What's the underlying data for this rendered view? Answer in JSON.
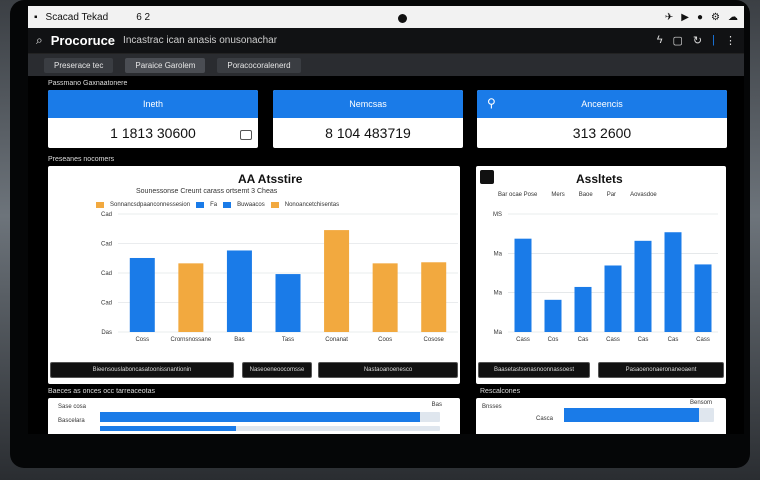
{
  "os_bar": {
    "app_name": "Scacad Tekad",
    "counter": "6 2"
  },
  "header": {
    "title": "Procoruce",
    "subtitle": "Incastrac ican anasis onusonachar"
  },
  "tabs": [
    {
      "label": "Preserace tec"
    },
    {
      "label": "Paraice Garolem"
    },
    {
      "label": "Poracocoralenerd"
    }
  ],
  "kpis": {
    "caption": "Passmano Gaxnaatonere",
    "items": [
      {
        "label": "Ineth",
        "value": "1 1813 30600"
      },
      {
        "label": "Nemcsas",
        "value": "8 104 483719"
      },
      {
        "label": "Anceencis",
        "value": "313 2600"
      }
    ]
  },
  "section_caption": "Preseanes nocomers",
  "chart_left": {
    "title": "AA Atsstire",
    "subtitle": "Sounessonse   Creunt carass ortsemt 3   Cheas",
    "legend": [
      "Sonnancsdpaanconnessesion",
      "Fa",
      "Buwaacos",
      "Nonoancetchisentas"
    ],
    "y_ticks": [
      "Cad",
      "Cad",
      "Cad",
      "Cad",
      "Das"
    ],
    "buttons": [
      "Bieensouslaboncasatoonissnantionin",
      "Naseoeneoocomsse",
      "Nastaoanoenesco"
    ]
  },
  "chart_right": {
    "title": "Assltets",
    "header_items": [
      "Bar ocae Pose",
      "Mers",
      "Baoe",
      "Par",
      "Aovasdoe"
    ],
    "y_ticks": [
      "MS",
      "Ma",
      "Ma",
      "Ma"
    ],
    "buttons": [
      "Baasetastsenasnoonnassoest",
      "Pasaoenonaeronaneoaent"
    ]
  },
  "bottom_left": {
    "caption": "Baeces as onces occ tarreaceotas",
    "rows": [
      {
        "label": "Sase cosa",
        "value": "Bas"
      },
      {
        "label": "Bascelara",
        "value": ""
      }
    ],
    "progress": [
      0.94,
      0.4
    ]
  },
  "bottom_right": {
    "caption": "Rescalcones",
    "rows": [
      {
        "label": "Bnsses",
        "value": "Bensom"
      },
      {
        "label": "Casca",
        "value": ""
      }
    ],
    "progress": [
      0.9
    ]
  },
  "colors": {
    "blue": "#1a7be8",
    "orange": "#f2a93f"
  },
  "chart_data": [
    {
      "type": "bar",
      "title": "AA Atsstire",
      "categories": [
        "Coss",
        "Crornsnossane",
        "Bas",
        "Tass",
        "Conanat",
        "Coos",
        "Cosose"
      ],
      "values": [
        69,
        64,
        76,
        54,
        95,
        64,
        65
      ],
      "colors": [
        "#1a7be8",
        "#f2a93f",
        "#1a7be8",
        "#1a7be8",
        "#f2a93f",
        "#f2a93f",
        "#f2a93f"
      ],
      "ylim": [
        0,
        110
      ],
      "grid": true
    },
    {
      "type": "bar",
      "title": "Assltets",
      "categories": [
        "Cass",
        "Cos",
        "Cas",
        "Cass",
        "Cas",
        "Cas",
        "Cass"
      ],
      "values": [
        87,
        30,
        42,
        62,
        85,
        93,
        63
      ],
      "ylim": [
        0,
        110
      ],
      "grid": true
    }
  ]
}
